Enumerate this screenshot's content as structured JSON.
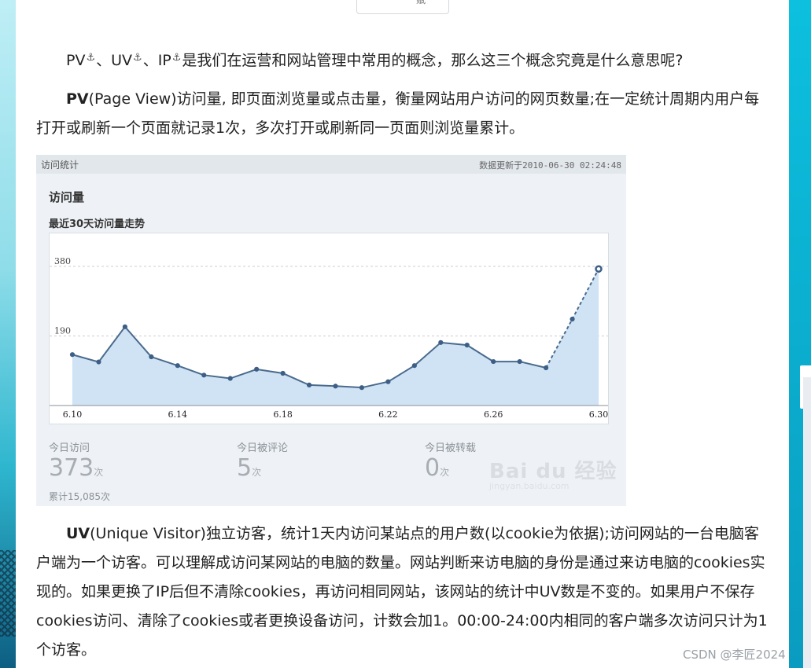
{
  "article": {
    "intro": {
      "t1": "PV",
      "t2": "、UV",
      "t3": "、IP",
      "t4": "是我们在运营和网站管理中常用的概念，那么这三个概念究竟是什么意思呢?",
      "anchor_glyph": "⚓"
    },
    "pv": {
      "term": "PV",
      "text": "(Page View)访问量, 即页面浏览量或点击量，衡量网站用户访问的网页数量;在一定统计周期内用户每打开或刷新一个页面就记录1次，多次打开或刷新同一页面则浏览量累计。"
    },
    "uv": {
      "term": "UV",
      "text": "(Unique Visitor)独立访客，统计1天内访问某站点的用户数(以cookie为依据);访问网站的一台电脑客户端为一个访客。可以理解成访问某网站的电脑的数量。网站判断来访电脑的身份是通过来访电脑的cookies实现的。如果更换了IP后但不清除cookies，再访问相同网站，该网站的统计中UV数是不变的。如果用户不保存cookies访问、清除了cookies或者更换设备访问，计数会加1。00:00-24:00内相同的客户端多次访问只计为1个访客。"
    }
  },
  "stats_image": {
    "header_title": "访问统计",
    "header_update": "数据更新于2010-06-30 02:24:48",
    "section_title": "访问量",
    "chart_title": "最近30天访问量走势",
    "today_visits_label": "今日访问",
    "today_visits_value": "373",
    "today_visits_unit": "次",
    "today_comments_label": "今日被评论",
    "today_comments_value": "5",
    "today_comments_unit": "次",
    "today_reposts_label": "今日被转载",
    "today_reposts_value": "0",
    "today_reposts_unit": "次",
    "cumulative": "累计15,085次",
    "watermark": "Bai du 经验",
    "watermark_sub": "jingyan.baidu.com"
  },
  "chart_data": {
    "type": "area",
    "title": "最近30天访问量走势",
    "x": [
      "6.10",
      "6.11",
      "6.12",
      "6.13",
      "6.14",
      "6.15",
      "6.16",
      "6.17",
      "6.18",
      "6.19",
      "6.20",
      "6.21",
      "6.22",
      "6.23",
      "6.24",
      "6.25",
      "6.26",
      "6.27",
      "6.28",
      "6.29",
      "6.30"
    ],
    "x_tick_labels": [
      "6.10",
      "6.14",
      "6.18",
      "6.22",
      "6.26",
      "6.30"
    ],
    "values": [
      139,
      119,
      215,
      133,
      109,
      83,
      74,
      99,
      88,
      56,
      53,
      49,
      65,
      109,
      172,
      165,
      120,
      120,
      103,
      236,
      373
    ],
    "y_ticks": [
      190,
      380
    ],
    "ylim": [
      0,
      470
    ],
    "grid": "horizontal dashed at y ticks",
    "colors": {
      "fill": "#cfe3f5",
      "line": "#4a6a8c",
      "point": "#3d5f86"
    }
  },
  "footer": {
    "mark": "CSDN @李匠2024"
  }
}
